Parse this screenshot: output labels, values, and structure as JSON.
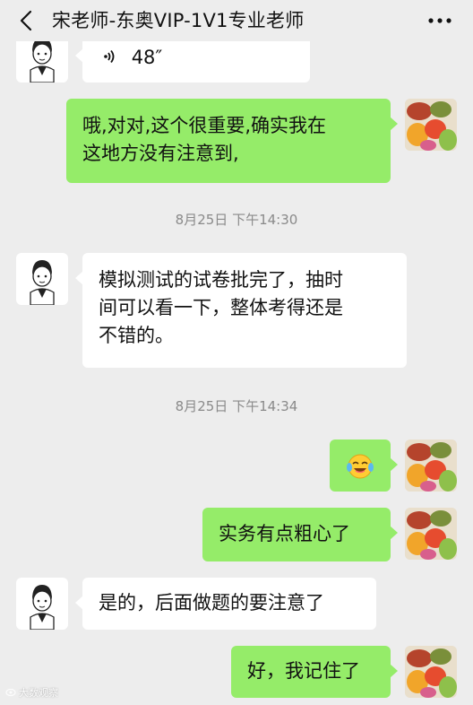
{
  "header": {
    "title": "宋老师-东奥VIP-1V1专业老师",
    "back_icon": "chevron-left-icon",
    "more_icon": "more-dots-icon"
  },
  "messages": [
    {
      "from": "teacher",
      "type": "voice",
      "duration": "48″"
    },
    {
      "from": "me",
      "type": "text",
      "lines": [
        "哦,对对,这个很重要,确实我在",
        "这地方没有注意到,"
      ]
    },
    {
      "type": "time",
      "text": "8月25日 下午14:30"
    },
    {
      "from": "teacher",
      "type": "text",
      "lines": [
        "模拟测试的试卷批完了，抽时",
        "间可以看一下，整体考得还是",
        "不错的。"
      ]
    },
    {
      "type": "time",
      "text": "8月25日 下午14:34"
    },
    {
      "from": "me",
      "type": "emoji",
      "emoji": "😂"
    },
    {
      "from": "me",
      "type": "text",
      "lines": [
        "实务有点粗心了"
      ]
    },
    {
      "from": "teacher",
      "type": "text",
      "lines": [
        "是的，后面做题的要注意了"
      ]
    },
    {
      "from": "me",
      "type": "text",
      "lines": [
        "好，我记住了"
      ]
    }
  ],
  "watermark": {
    "text": "大数观察",
    "icon": "sina-eye-icon"
  },
  "colors": {
    "background": "#ededed",
    "sent_bubble": "#95ec69",
    "received_bubble": "#ffffff",
    "timestamp": "#8a8a8a"
  }
}
